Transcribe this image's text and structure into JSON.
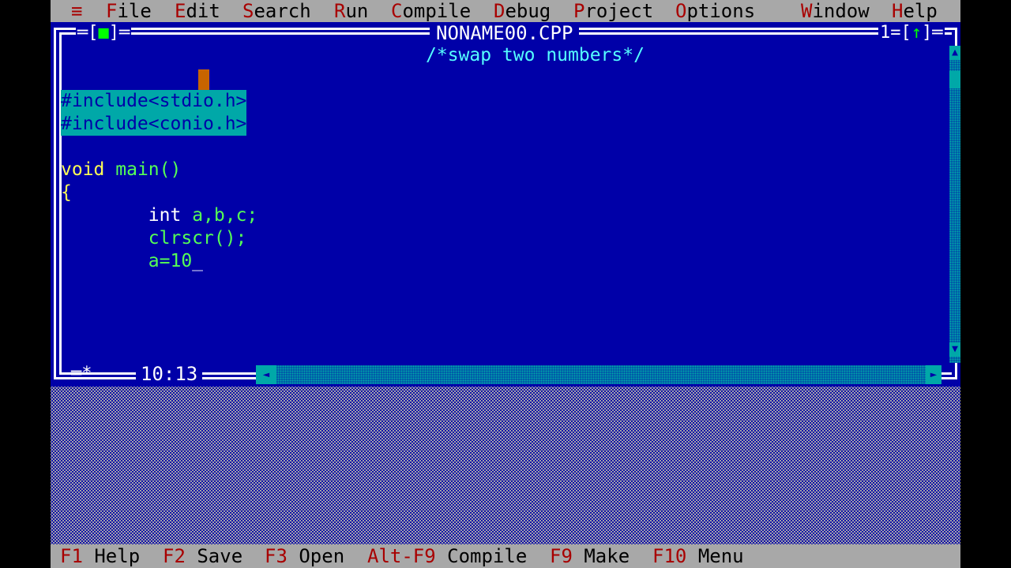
{
  "menu": {
    "system_icon": "≡",
    "items": [
      {
        "hot": "F",
        "rest": "ile"
      },
      {
        "hot": "E",
        "rest": "dit"
      },
      {
        "hot": "S",
        "rest": "earch"
      },
      {
        "hot": "R",
        "rest": "un"
      },
      {
        "hot": "C",
        "rest": "ompile"
      },
      {
        "hot": "D",
        "rest": "ebug"
      },
      {
        "hot": "P",
        "rest": "roject"
      },
      {
        "hot": "O",
        "rest": "ptions"
      },
      {
        "hot": "W",
        "rest": "indow"
      },
      {
        "hot": "H",
        "rest": "elp"
      }
    ]
  },
  "window": {
    "close_left": "═[",
    "close_mark": "■",
    "close_right": "]═",
    "title": "NONAME00.CPP",
    "number": "1=[",
    "zoom_mark": "↑",
    "number_end": "]═",
    "position": "10:13",
    "star": "═*"
  },
  "code": {
    "comment": "/*swap two numbers*/",
    "include1": "#include<stdio.h>",
    "include2": "#include<conio.h>",
    "void_kw": "void",
    "main": "main()",
    "brace": "{",
    "int_kw": "int",
    "vars": "a,b,c;",
    "clrscr": "clrscr();",
    "assign": "a=10",
    "cursor": "_"
  },
  "scroll": {
    "up": "▲",
    "down": "▼",
    "left": "◄",
    "right": "►"
  },
  "status": [
    {
      "key": "F1",
      "label": "Help"
    },
    {
      "key": "F2",
      "label": "Save"
    },
    {
      "key": "F3",
      "label": "Open"
    },
    {
      "key": "Alt-F9",
      "label": "Compile"
    },
    {
      "key": "F9",
      "label": "Make"
    },
    {
      "key": "F10",
      "label": "Menu"
    }
  ],
  "colors": {
    "background": "#0000a8",
    "menu": "#a8a8a8",
    "hotkey": "#a80000",
    "selection": "#00a8a8"
  }
}
